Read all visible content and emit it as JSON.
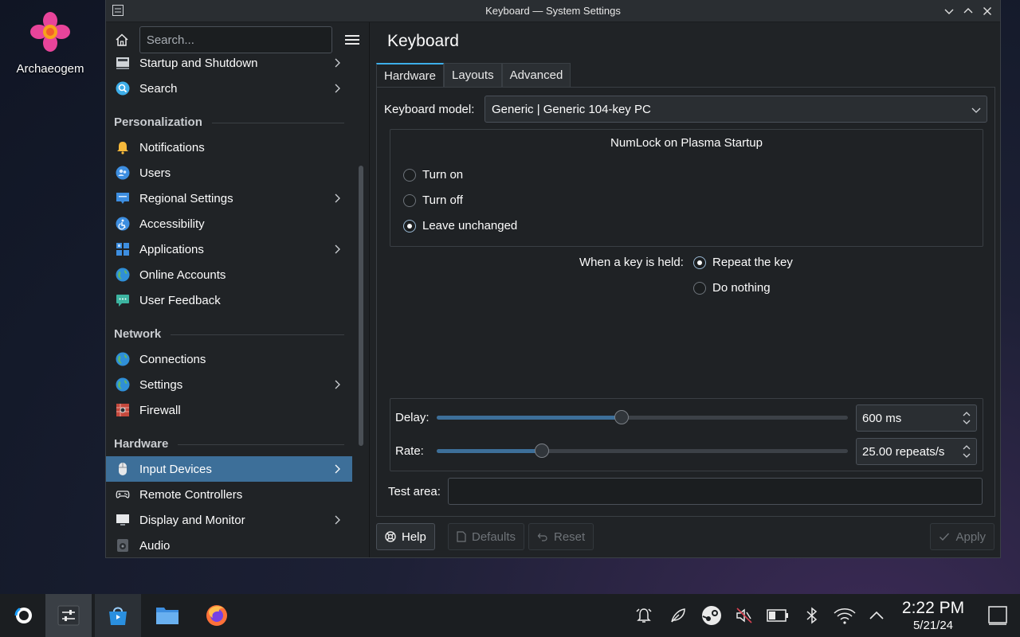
{
  "desktop": {
    "icon_label": "Archaeogem",
    "icon_name": "archaeogem-flower-icon"
  },
  "window": {
    "title": "Keyboard — System Settings"
  },
  "sidebar": {
    "search_placeholder": "Search...",
    "items_top": [
      {
        "label": "Startup and Shutdown",
        "icon": "startup-icon",
        "has_children": true
      },
      {
        "label": "Search",
        "icon": "search-icon",
        "has_children": true
      }
    ],
    "categories": [
      {
        "title": "Personalization",
        "items": [
          {
            "label": "Notifications",
            "icon": "bell-icon",
            "has_children": false
          },
          {
            "label": "Users",
            "icon": "users-icon",
            "has_children": false
          },
          {
            "label": "Regional Settings",
            "icon": "flag-icon",
            "has_children": true
          },
          {
            "label": "Accessibility",
            "icon": "accessibility-icon",
            "has_children": false
          },
          {
            "label": "Applications",
            "icon": "applications-icon",
            "has_children": true
          },
          {
            "label": "Online Accounts",
            "icon": "globe-icon",
            "has_children": false
          },
          {
            "label": "User Feedback",
            "icon": "feedback-icon",
            "has_children": false
          }
        ]
      },
      {
        "title": "Network",
        "items": [
          {
            "label": "Connections",
            "icon": "globe-icon",
            "has_children": false
          },
          {
            "label": "Settings",
            "icon": "globe-icon",
            "has_children": true
          },
          {
            "label": "Firewall",
            "icon": "firewall-icon",
            "has_children": false
          }
        ]
      },
      {
        "title": "Hardware",
        "items": [
          {
            "label": "Input Devices",
            "icon": "mouse-icon",
            "has_children": true,
            "active": true
          },
          {
            "label": "Remote Controllers",
            "icon": "gamepad-icon",
            "has_children": false
          },
          {
            "label": "Display and Monitor",
            "icon": "monitor-icon",
            "has_children": true
          },
          {
            "label": "Audio",
            "icon": "speaker-icon",
            "has_children": false
          }
        ]
      }
    ]
  },
  "main": {
    "title": "Keyboard",
    "tabs": [
      "Hardware",
      "Layouts",
      "Advanced"
    ],
    "active_tab": "Hardware",
    "keyboard_model_label": "Keyboard model:",
    "keyboard_model_value": "Generic | Generic 104-key PC",
    "numlock": {
      "title": "NumLock on Plasma Startup",
      "options": [
        "Turn on",
        "Turn off",
        "Leave unchanged"
      ],
      "selected": "Leave unchanged"
    },
    "key_held": {
      "label": "When a key is held:",
      "options": [
        "Repeat the key",
        "Do nothing"
      ],
      "selected": "Repeat the key"
    },
    "delay": {
      "label": "Delay:",
      "value": "600 ms",
      "slider_fraction": 0.45
    },
    "rate": {
      "label": "Rate:",
      "value": "25.00 repeats/s",
      "slider_fraction": 0.255
    },
    "test_area_label": "Test area:",
    "buttons": {
      "help": "Help",
      "defaults": "Defaults",
      "reset": "Reset",
      "apply": "Apply"
    }
  },
  "taskbar": {
    "items": [
      "steam-launcher-icon",
      "system-settings-icon",
      "discover-store-icon",
      "file-manager-icon",
      "firefox-icon"
    ],
    "tray": [
      "notifications-icon",
      "leaf-icon",
      "steam-icon",
      "volume-muted-icon",
      "battery-icon",
      "bluetooth-icon",
      "wifi-icon",
      "expand-tray-icon"
    ],
    "time": "2:22 PM",
    "date": "5/21/24"
  },
  "colors": {
    "accent": "#3daee9",
    "selection": "#3d6f99",
    "window_bg": "#202326"
  }
}
